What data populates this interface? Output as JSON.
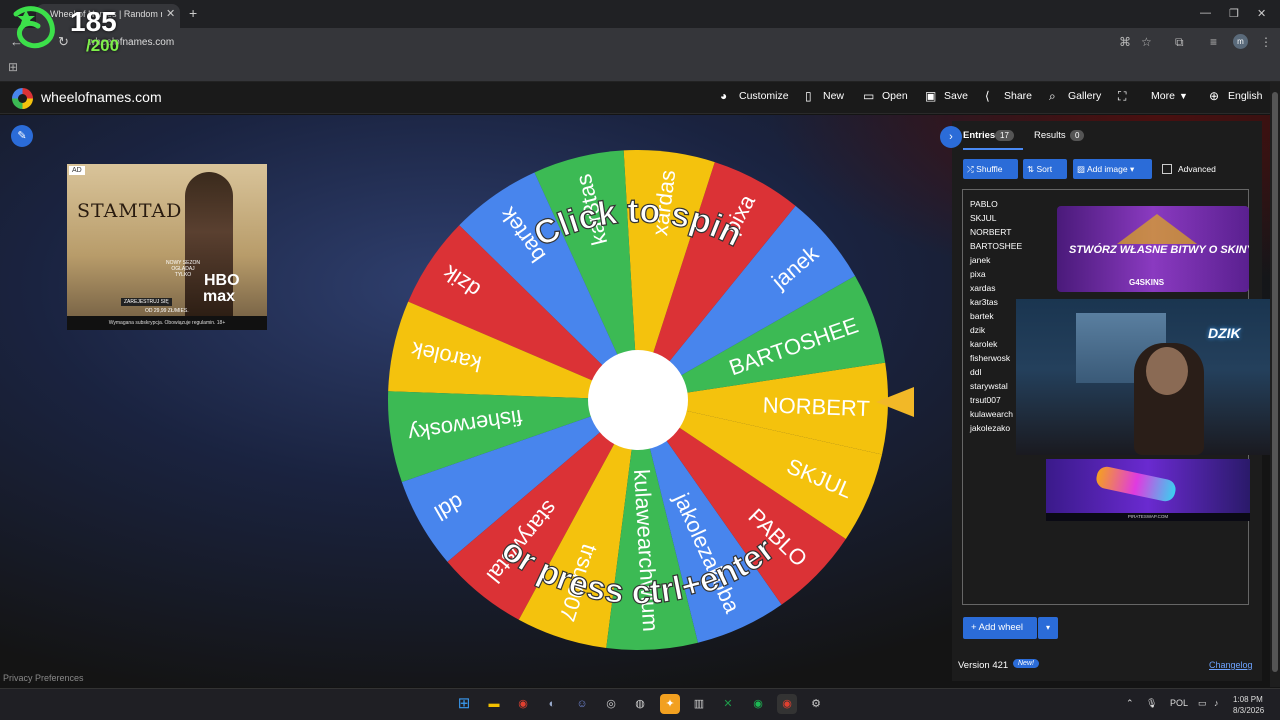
{
  "browser": {
    "tab_title": "Wheel of Names | Random name picker",
    "url": "wheelofnames.com"
  },
  "overlay": {
    "count": "185",
    "total": "/200"
  },
  "site": {
    "name": "wheelofnames.com",
    "menu": [
      {
        "label": "Customize",
        "icon": "palette-icon"
      },
      {
        "label": "New",
        "icon": "new-file-icon"
      },
      {
        "label": "Open",
        "icon": "folder-icon"
      },
      {
        "label": "Save",
        "icon": "save-icon"
      },
      {
        "label": "Share",
        "icon": "share-icon"
      },
      {
        "label": "Gallery",
        "icon": "search-icon"
      },
      {
        "label": "",
        "icon": "fullscreen-icon"
      },
      {
        "label": "More",
        "icon": "chevron-down-icon"
      },
      {
        "label": "English",
        "icon": "globe-icon"
      }
    ]
  },
  "ad": {
    "badge": "AD",
    "title": "STAMTAD",
    "brand_top": "HBO",
    "brand_bottom": "max",
    "tagline": "NOWY SEZON OGLĄDAJ TYLKO",
    "cta": "ZAREJESTRUJ SIĘ",
    "price": "OD 29,99 ZŁ/MIES.",
    "footer": "Wymagana subskrypcja. Obowiązuje regulamin. 18+"
  },
  "wheel": {
    "center_text_top": "Click to spin",
    "center_text_bottom": "or press ctrl+enter",
    "segments": [
      "NORBERT",
      "BARTOSHEE",
      "janek",
      "pixa",
      "xardas",
      "kar3tas",
      "bartek",
      "dzik",
      "karolek",
      "fisherwosky",
      "ddl",
      "starywstal",
      "trsut007",
      "kulawearchwium",
      "jakolezakoba",
      "PABLO",
      "SKJUL"
    ],
    "colors": {
      "green": "#3cba54",
      "yellow": "#f4c20d",
      "red": "#db3236",
      "blue": "#4885ed"
    }
  },
  "privacy": "Privacy Preferences",
  "panel": {
    "tab_entries": "Entries",
    "entries_count": "17",
    "tab_results": "Results",
    "results_count": "0",
    "shuffle": "Shuffle",
    "sort": "Sort",
    "add_image": "Add image",
    "advanced": "Advanced",
    "entries": [
      "PABLO",
      "SKJUL",
      "NORBERT",
      "BARTOSHEE",
      "janek",
      "pixa",
      "xardas",
      "kar3tas",
      "bartek",
      "dzik",
      "karolek",
      "fisherwosk",
      "ddl",
      "starywstal",
      "trsut007",
      "kulawearch",
      "jakolezako"
    ],
    "add_wheel": "Add wheel",
    "version": "Version 421",
    "new_badge": "New!",
    "changelog": "Changelog"
  },
  "promo1": {
    "text": "STWÓRZ WŁASNE BITWY O SKINY!",
    "brand": "G4SKINS"
  },
  "webcam": {
    "logo": "DZIK"
  },
  "promo2": {
    "footer": "PIRATESWAP.COM"
  },
  "taskbar": {
    "lang": "POL",
    "time": "1:08 PM",
    "date": "8/3/2026"
  }
}
